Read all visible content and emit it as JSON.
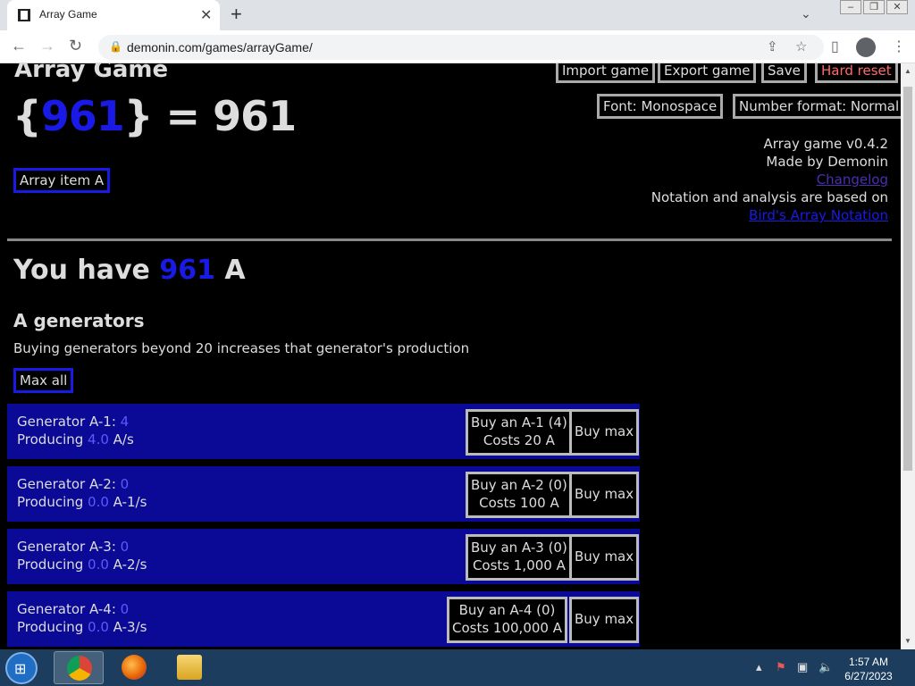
{
  "browser": {
    "tab_title": "Array Game",
    "url": "demonin.com/games/arrayGame/"
  },
  "game": {
    "title": "Array Game",
    "array_open": "{",
    "array_value": "961",
    "array_close": "} = 961",
    "array_item_button": "Array item A",
    "buttons": {
      "import": "Import game",
      "export": "Export game",
      "save": "Save",
      "hard_reset": "Hard reset",
      "font": "Font: Monospace",
      "number_format": "Number format: Normal"
    },
    "info": {
      "version": "Array game v0.4.2",
      "author": "Made by Demonin",
      "changelog": "Changelog",
      "notation_note": "Notation and analysis are based on",
      "notation_link": "Bird's Array Notation"
    },
    "you_have_prefix": "You have ",
    "you_have_amount": "961",
    "you_have_suffix": " A",
    "generators_heading": "A generators",
    "generators_note": "Buying generators beyond 20 increases that generator's production",
    "max_all": "Max all",
    "generators": [
      {
        "name": "Generator A-1: ",
        "count": "4",
        "producing_label": "Producing ",
        "rate": "4.0",
        "unit": " A/s",
        "buy_line1": "Buy an A-1 (4)",
        "buy_line2": "Costs 20 A",
        "buy_max": "Buy max"
      },
      {
        "name": "Generator A-2: ",
        "count": "0",
        "producing_label": "Producing ",
        "rate": "0.0",
        "unit": " A-1/s",
        "buy_line1": "Buy an A-2 (0)",
        "buy_line2": "Costs 100 A",
        "buy_max": "Buy max"
      },
      {
        "name": "Generator A-3: ",
        "count": "0",
        "producing_label": "Producing ",
        "rate": "0.0",
        "unit": " A-2/s",
        "buy_line1": "Buy an A-3 (0)",
        "buy_line2": "Costs 1,000 A",
        "buy_max": "Buy max"
      },
      {
        "name": "Generator A-4: ",
        "count": "0",
        "producing_label": "Producing ",
        "rate": "0.0",
        "unit": " A-3/s",
        "buy_line1": "Buy an A-4 (0)",
        "buy_line2": "Costs 100,000 A",
        "buy_max": "Buy max"
      }
    ]
  },
  "taskbar": {
    "time": "1:57 AM",
    "date": "6/27/2023"
  }
}
